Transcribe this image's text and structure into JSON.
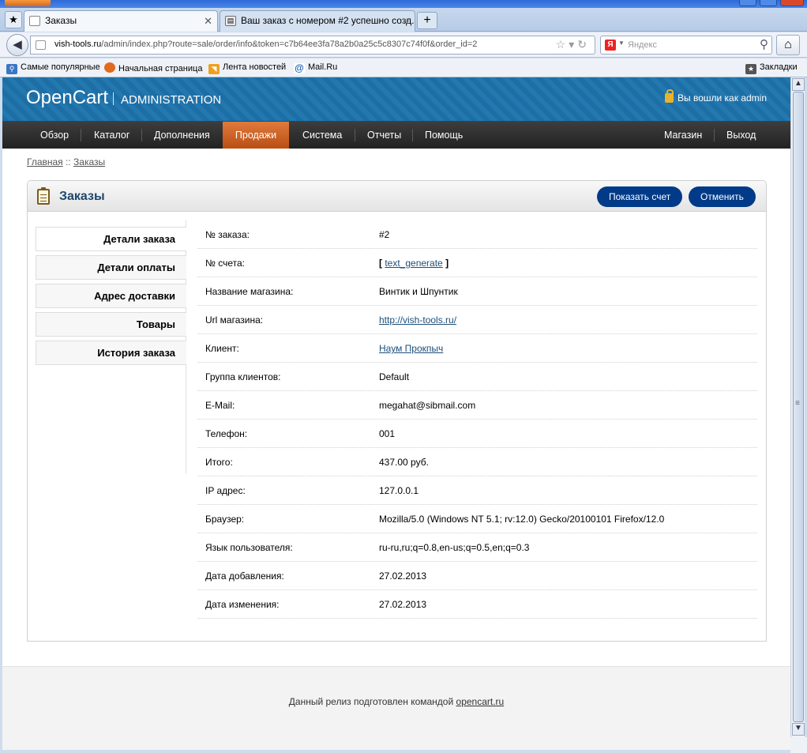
{
  "browser": {
    "tabs": [
      {
        "label": "Заказы",
        "active": true
      },
      {
        "label": "Ваш заказ с номером #2 успешно созд...",
        "active": false
      }
    ],
    "url_host": "vish-tools.ru",
    "url_path": "/admin/index.php?route=sale/order/info&token=c7b64ee3fa78a2b0a25c5c8307c74f0f&order_id=2",
    "search_placeholder": "Яндекс",
    "bookmarks": [
      "Самые популярные",
      "Начальная страница",
      "Лента новостей",
      "Mail.Ru"
    ],
    "bookmarks_right": "Закладки"
  },
  "header": {
    "logo": "OpenCart",
    "admin": "ADMINISTRATION",
    "logged_in": "Вы вошли как admin"
  },
  "menu": {
    "left": [
      "Обзор",
      "Каталог",
      "Дополнения",
      "Продажи",
      "Система",
      "Отчеты",
      "Помощь"
    ],
    "active": "Продажи",
    "right": [
      "Магазин",
      "Выход"
    ]
  },
  "breadcrumb": {
    "home": "Главная",
    "sep": " :: ",
    "current": "Заказы"
  },
  "box": {
    "title": "Заказы",
    "buttons": {
      "invoice": "Показать счет",
      "cancel": "Отменить"
    }
  },
  "vtabs": [
    "Детали заказа",
    "Детали оплаты",
    "Адрес доставки",
    "Товары",
    "История заказа"
  ],
  "order_info": [
    {
      "label": "№ заказа:",
      "value": "#2"
    },
    {
      "label": "№ счета:",
      "value": "text_generate"
    },
    {
      "label": "Название магазина:",
      "value": "Винтик и Шпунтик"
    },
    {
      "label": "Url магазина:",
      "value": "http://vish-tools.ru/"
    },
    {
      "label": "Клиент:",
      "value": "Наум Прокпыч"
    },
    {
      "label": "Группа клиентов:",
      "value": "Default"
    },
    {
      "label": "E-Mail:",
      "value": "megahat@sibmail.com"
    },
    {
      "label": "Телефон:",
      "value": "001"
    },
    {
      "label": "Итого:",
      "value": "437.00 руб."
    },
    {
      "label": "IP адрес:",
      "value": "127.0.0.1"
    },
    {
      "label": "Браузер:",
      "value": "Mozilla/5.0 (Windows NT 5.1; rv:12.0) Gecko/20100101 Firefox/12.0"
    },
    {
      "label": "Язык пользователя:",
      "value": "ru-ru,ru;q=0.8,en-us;q=0.5,en;q=0.3"
    },
    {
      "label": "Дата добавления:",
      "value": "27.02.2013"
    },
    {
      "label": "Дата изменения:",
      "value": "27.02.2013"
    }
  ],
  "footer": {
    "text": "Данный релиз подготовлен командой ",
    "link": "opencart.ru"
  }
}
